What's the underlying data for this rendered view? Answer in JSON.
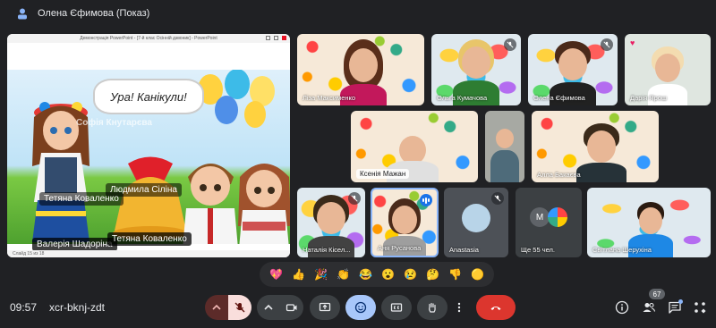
{
  "header": {
    "presenter_title": "Олена Єфимова (Показ)"
  },
  "presentation": {
    "window_title": "Демонстрація PowerPoint - [7-й клас Осінній дзвоник] - PowerPoint",
    "slide_text": "Ура! Канікули!",
    "status_text": "Слайд 15 из 18",
    "overlay_names": [
      {
        "text": "Софія Кнутарєва"
      },
      {
        "text": "Людмила Сіліна"
      },
      {
        "text": "Тетяна Коваленко"
      },
      {
        "text": "Валерія Шадоріна"
      },
      {
        "text": "Тетяна Коваленко"
      }
    ]
  },
  "participants": [
    {
      "name": "Ліза Максименко"
    },
    {
      "name": "Ольга Кумачова"
    },
    {
      "name": "Олена Єфимова"
    },
    {
      "name": "Дарія Ярош"
    },
    {
      "name": "Ксенія Мажан"
    },
    {
      "name": ""
    },
    {
      "name": "Алла Бакаєва"
    },
    {
      "name": "Наталія Кісел..."
    },
    {
      "name": "Аня Русанова"
    },
    {
      "name": "Anastasia"
    },
    {
      "name": "Ще 55 чел."
    },
    {
      "name": "Світлана Шерухіна"
    }
  ],
  "others_tile": {
    "initial": "М"
  },
  "reactions": [
    "💖",
    "👍",
    "🎉",
    "👏",
    "😂",
    "😮",
    "😢",
    "🤔",
    "👎",
    "🟡"
  ],
  "footer": {
    "time": "09:57",
    "meeting_code": "xcr-bknj-zdt",
    "participant_count": "67"
  },
  "colors": {
    "background": "#202124",
    "control": "#3c4043",
    "mic_muted_bg": "#f9dedc",
    "emoji_active_bg": "#a8c7fa",
    "leave_red": "#dc362e"
  }
}
